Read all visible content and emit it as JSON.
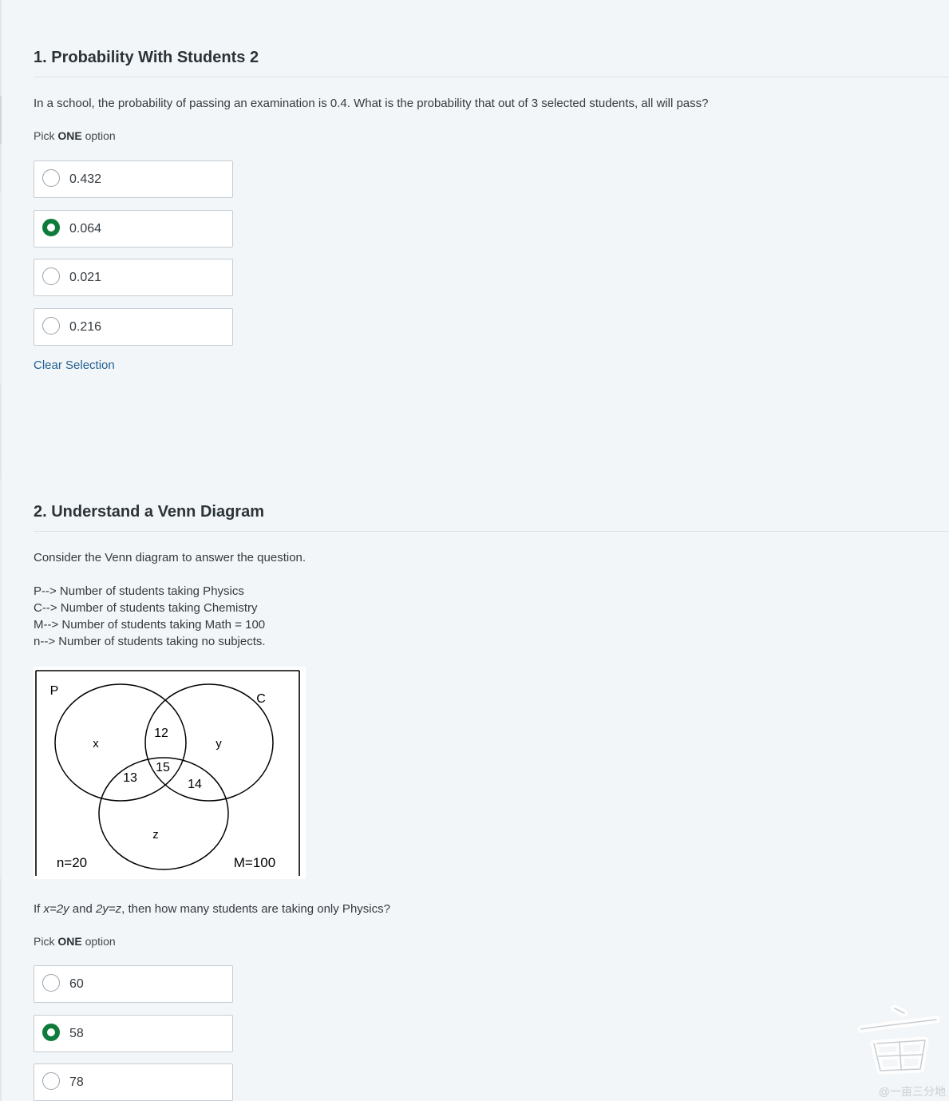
{
  "q1": {
    "title": "1. Probability With Students 2",
    "text": "In a school, the probability of passing an examination is 0.4. What is the probability that out of 3 selected students, all will pass?",
    "pick_prefix": "Pick ",
    "pick_bold": "ONE",
    "pick_suffix": " option",
    "options": [
      {
        "label": "0.432",
        "selected": false
      },
      {
        "label": "0.064",
        "selected": true
      },
      {
        "label": "0.021",
        "selected": false
      },
      {
        "label": "0.216",
        "selected": false
      }
    ],
    "clear_label": "Clear Selection"
  },
  "q2": {
    "title": "2. Understand a Venn Diagram",
    "intro": "Consider the Venn diagram to answer the question.",
    "defs": [
      "P--> Number of students taking Physics",
      "C--> Number of students taking Chemistry",
      "M--> Number of students taking Math = 100",
      "n--> Number of students taking no subjects."
    ],
    "venn": {
      "label_p": "P",
      "label_c": "C",
      "x": "x",
      "y": "y",
      "z": "z",
      "pc": "12",
      "pcm": "15",
      "pm": "13",
      "cm": "14",
      "n": "n=20",
      "m": "M=100"
    },
    "question_prefix": "If ",
    "question_eq1": "x=2y",
    "question_mid": " and ",
    "question_eq2": "2y=z",
    "question_suffix": ", then how many students are taking only Physics?",
    "pick_prefix": "Pick ",
    "pick_bold": "ONE",
    "pick_suffix": " option",
    "options": [
      {
        "label": "60",
        "selected": false
      },
      {
        "label": "58",
        "selected": true
      },
      {
        "label": "78",
        "selected": false
      }
    ]
  },
  "watermark": {
    "text": "@一亩三分地"
  },
  "colors": {
    "selected_radio": "#0f7b3b",
    "link": "#1f5f92",
    "background": "#f3f6f8"
  }
}
